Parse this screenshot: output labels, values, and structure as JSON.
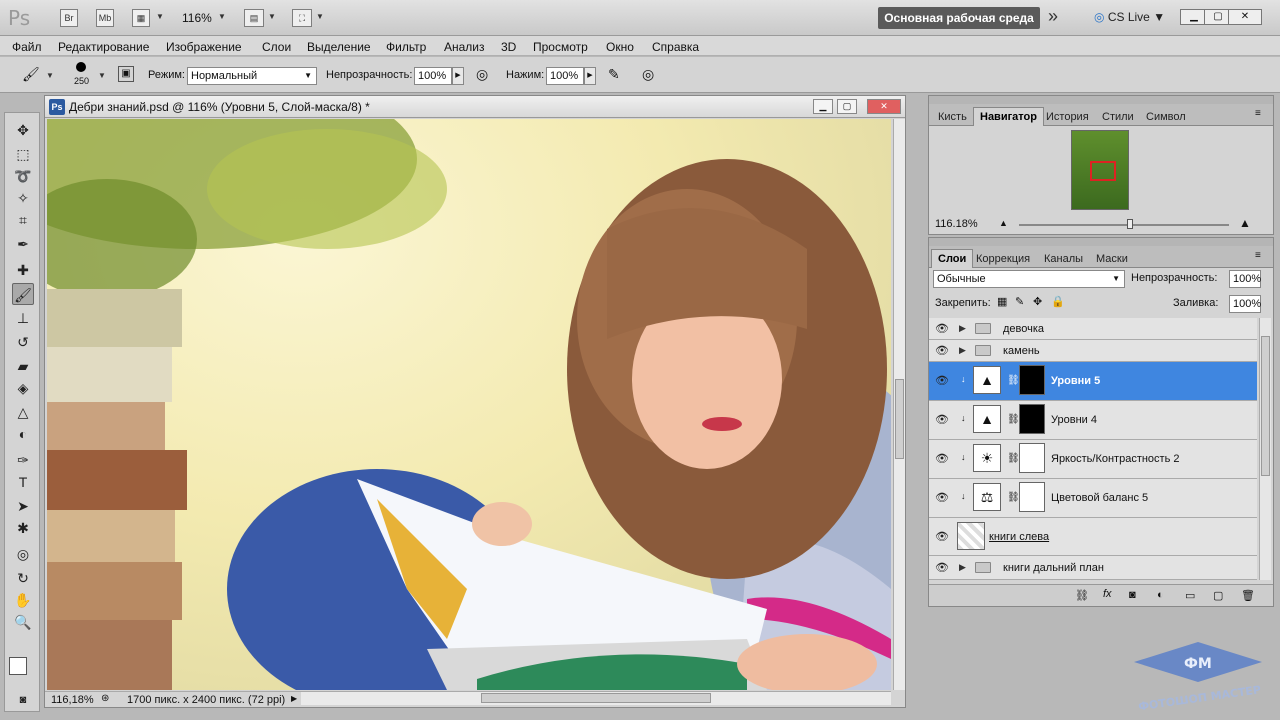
{
  "appbar": {
    "logo": "Ps",
    "br": "Br",
    "mb": "Mb",
    "zoom": "116%",
    "workspace": "Основная рабочая среда",
    "more": "»",
    "cslive": "CS Live"
  },
  "menu": [
    "Файл",
    "Редактирование",
    "Изображение",
    "Слои",
    "Выделение",
    "Фильтр",
    "Анализ",
    "3D",
    "Просмотр",
    "Окно",
    "Справка"
  ],
  "options": {
    "brush_size": "250",
    "mode_label": "Режим:",
    "mode_value": "Нормальный",
    "opacity_label": "Непрозрачность:",
    "opacity_value": "100%",
    "flow_label": "Нажим:",
    "flow_value": "100%"
  },
  "document": {
    "title": "Дебри знаний.psd @ 116% (Уровни 5, Слой-маска/8) *",
    "zoom": "116,18%",
    "info": "1700 пикс. x 2400 пикс. (72 ppi)"
  },
  "panel_top": {
    "tabs": [
      "Кисть",
      "Навигатор",
      "История",
      "Стили",
      "Символ"
    ],
    "active_tab": "Навигатор",
    "zoom": "116.18%"
  },
  "layers_panel": {
    "tabs": [
      "Слои",
      "Коррекция",
      "Каналы",
      "Маски"
    ],
    "active_tab": "Слои",
    "blend_mode": "Обычные",
    "opacity_label": "Непрозрачность:",
    "opacity_value": "100%",
    "lock_label": "Закрепить:",
    "fill_label": "Заливка:",
    "fill_value": "100%",
    "layers": [
      {
        "name": "девочка",
        "kind": "group"
      },
      {
        "name": "камень",
        "kind": "group"
      },
      {
        "name": "Уровни 5",
        "kind": "adjust",
        "selected": true
      },
      {
        "name": "Уровни 4",
        "kind": "adjust"
      },
      {
        "name": "Яркость/Контрастность 2",
        "kind": "adjust"
      },
      {
        "name": "Цветовой баланс 5",
        "kind": "adjust"
      },
      {
        "name": "книги слева",
        "kind": "pixel"
      },
      {
        "name": "книги дальний план",
        "kind": "group"
      }
    ]
  },
  "watermark": {
    "line1": "ФМ",
    "line2": "ФОТОШОП МАСТЕР"
  },
  "colors": {
    "selected_row": "#3f86e0",
    "workspace_btn": "#5a5a5a"
  }
}
